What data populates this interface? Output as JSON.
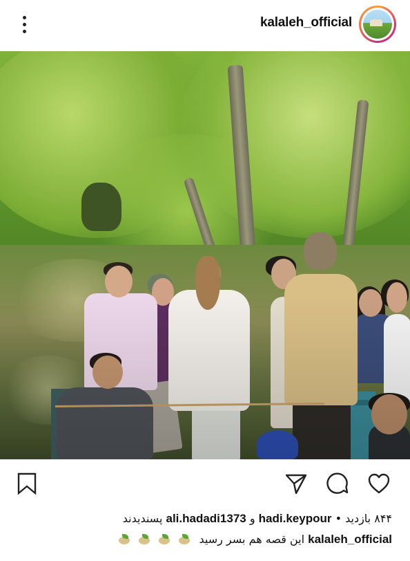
{
  "header": {
    "username": "kalaleh_official",
    "menu_icon": "more-vertical-icon"
  },
  "post": {
    "icons": {
      "bookmark": "bookmark-icon",
      "share": "send-icon",
      "comment": "comment-icon",
      "like": "heart-icon"
    },
    "views_text": "۸۴۴ بازدید",
    "liked_by_1": "hadi.keypour",
    "and_text": "و",
    "liked_by_2": "ali.hadadi1373",
    "liked_suffix": "پسندیدند",
    "bullet": "•",
    "caption_user": "kalaleh_official",
    "caption_text": "این قصه هم بسر رسید"
  },
  "colors": {
    "story_ring": "#e1306c",
    "text": "#111111",
    "background": "#ffffff"
  }
}
